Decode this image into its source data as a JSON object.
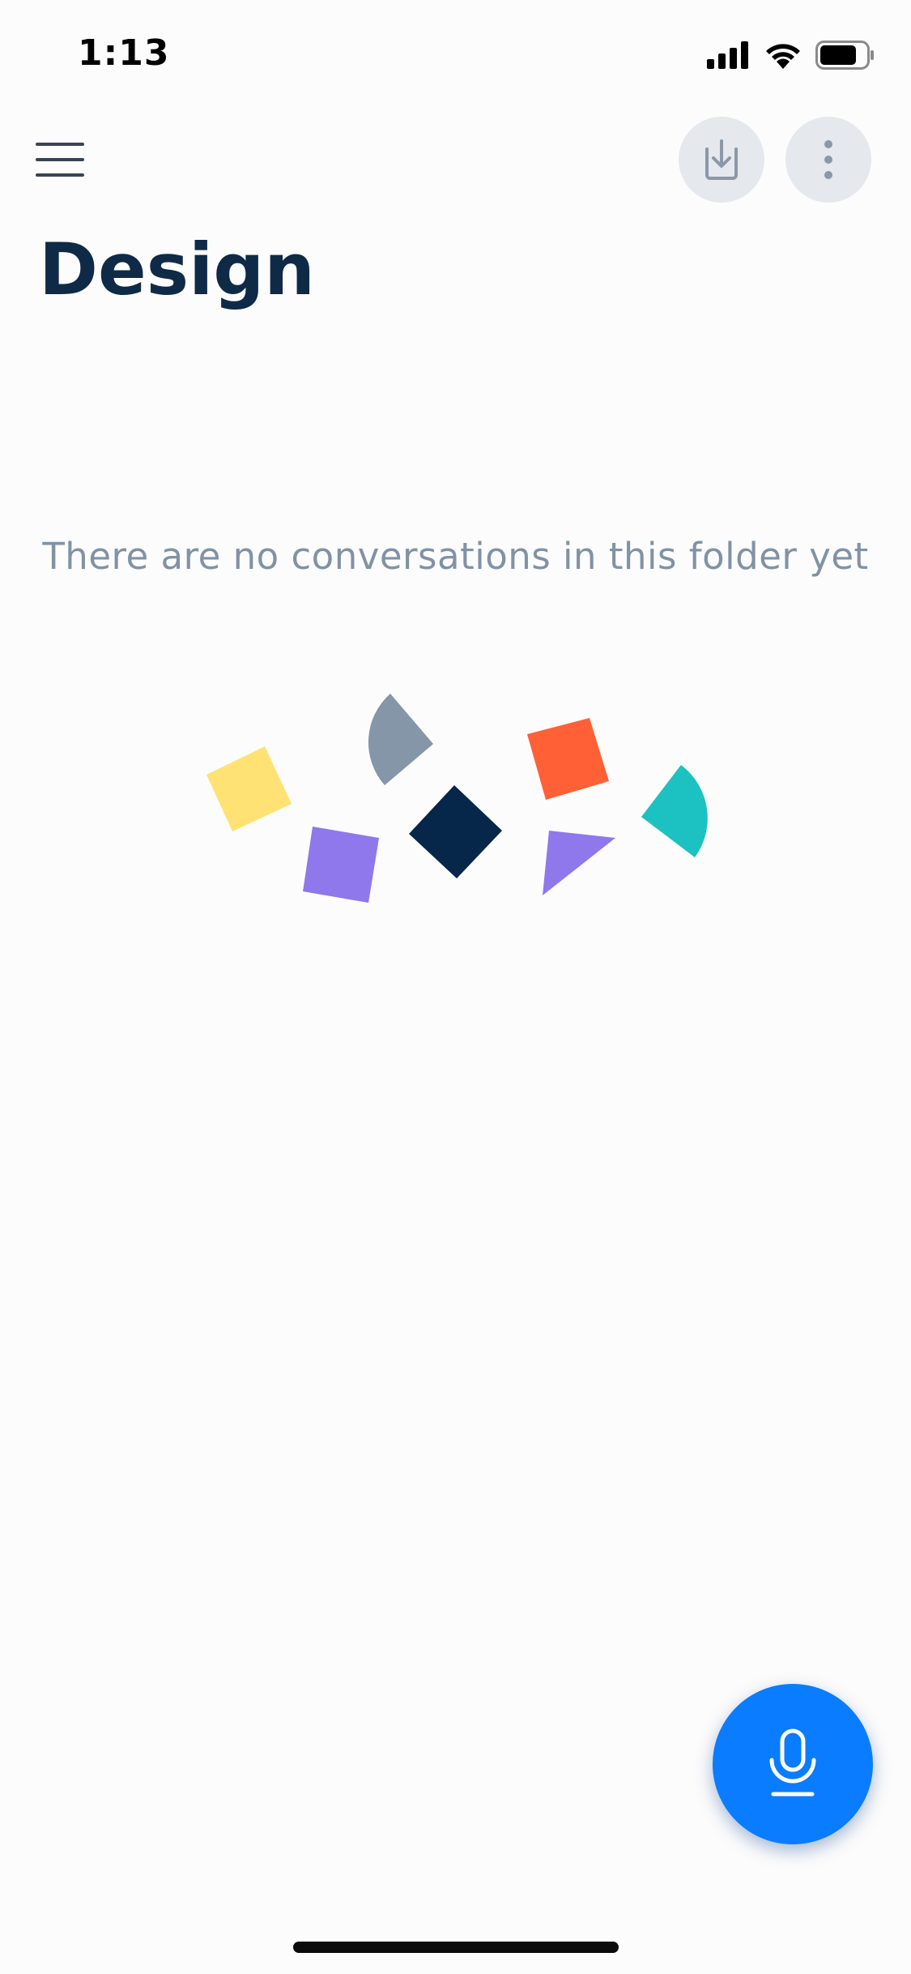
{
  "status_bar": {
    "time": "1:13",
    "icons": [
      "cellular-signal-icon",
      "wifi-icon",
      "battery-icon"
    ]
  },
  "nav": {
    "menu_icon": "hamburger-menu-icon",
    "actions": [
      {
        "name": "import-button",
        "icon": "download-tray-icon"
      },
      {
        "name": "more-options-button",
        "icon": "vertical-ellipsis-icon"
      }
    ]
  },
  "page": {
    "title": "Design",
    "empty_message": "There are no conversations in this folder yet"
  },
  "illustration": {
    "colors": {
      "yellow": "#ffe273",
      "gray": "#8496a8",
      "orange": "#ff6035",
      "teal": "#1cc1c2",
      "purple": "#8e78ec",
      "navy": "#06264a"
    }
  },
  "fab": {
    "icon": "microphone-icon",
    "color": "#0a7cff"
  },
  "colors": {
    "background": "#fcfcfc",
    "title": "#0e2a47",
    "muted_text": "#8192a5",
    "circle_button_bg": "#e5e8ec"
  }
}
